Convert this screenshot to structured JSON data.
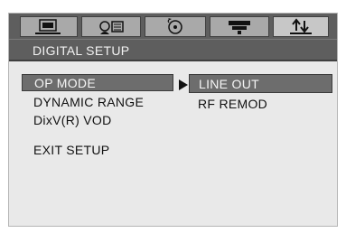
{
  "tabs": [
    {
      "icon": "monitor-icon"
    },
    {
      "icon": "speaker-icon"
    },
    {
      "icon": "disc-icon"
    },
    {
      "icon": "video-icon"
    },
    {
      "icon": "digital-setup-icon"
    }
  ],
  "title": "DIGITAL SETUP",
  "menu": {
    "op_mode": "OP MODE",
    "dynamic_range": "DYNAMIC RANGE",
    "divx": "DixV(R) VOD",
    "exit": "EXIT SETUP"
  },
  "submenu": {
    "line_out": "LINE OUT",
    "rf_remod": "RF REMOD"
  },
  "colors": {
    "bar": "#5e5e5e",
    "tab": "#a9a9a9",
    "highlight": "#6d6d6d",
    "background": "#e9e9e9"
  }
}
